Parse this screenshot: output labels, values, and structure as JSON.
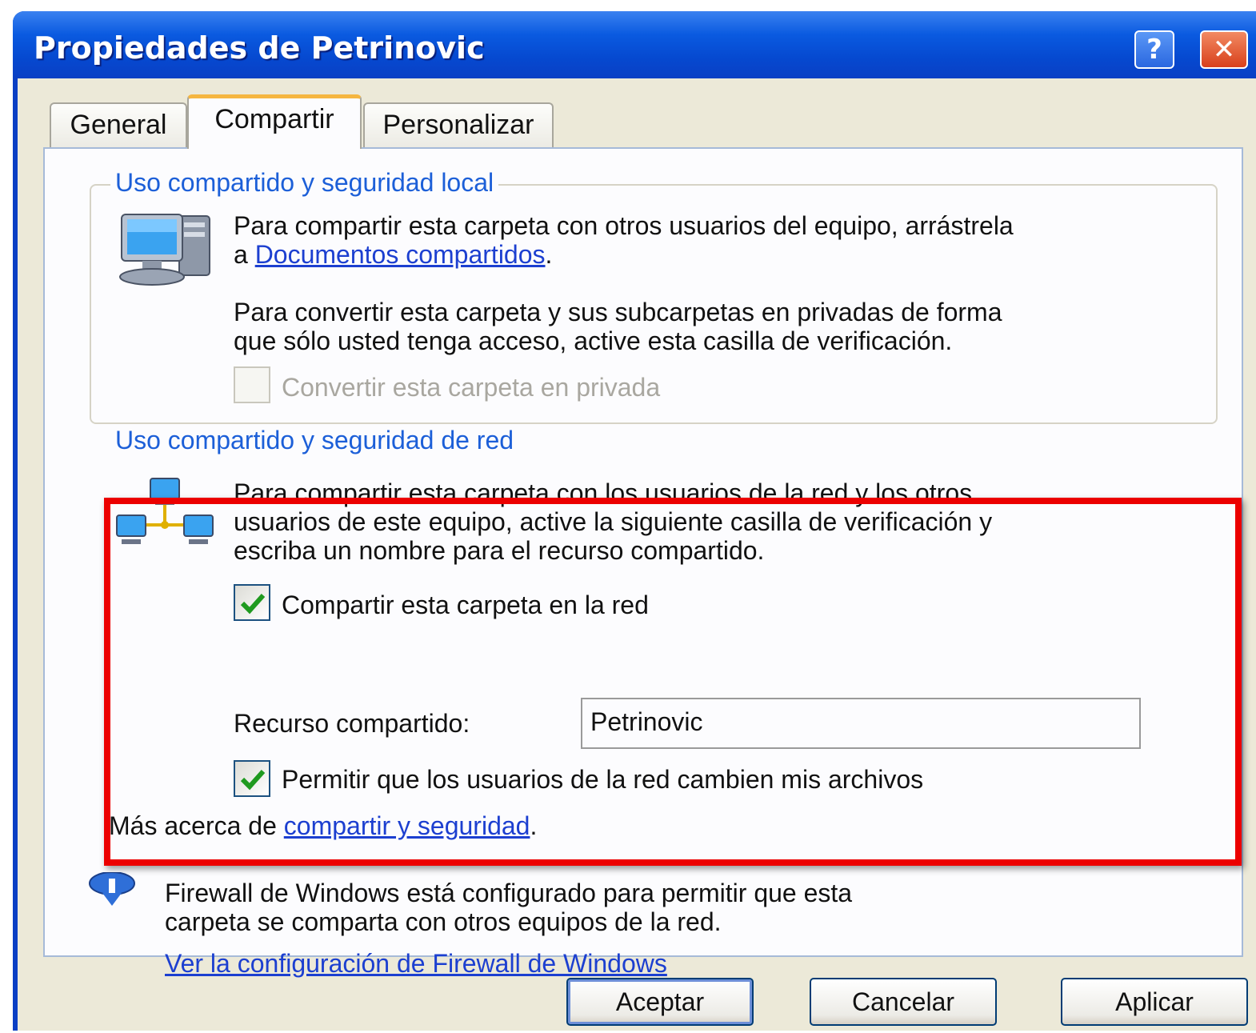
{
  "window": {
    "title": "Propiedades de Petrinovic",
    "help_label": "?",
    "close_label": "✕"
  },
  "tabs": [
    {
      "label": "General",
      "active": false
    },
    {
      "label": "Compartir",
      "active": true
    },
    {
      "label": "Personalizar",
      "active": false
    }
  ],
  "local_sharing": {
    "group_label": "Uso compartido y seguridad local",
    "text_1": "Para compartir esta carpeta con otros usuarios del equipo, arrástrela",
    "text_2_prefix": "a ",
    "link": "Documentos compartidos",
    "text_2_suffix": ".",
    "text_3": "Para convertir esta carpeta y sus subcarpetas en privadas de forma",
    "text_4": "que sólo usted tenga acceso, active esta casilla de verificación.",
    "private_checkbox_label": "Convertir esta carpeta en privada",
    "private_checked": false
  },
  "network_sharing": {
    "group_label": "Uso compartido y seguridad de red",
    "text_1": "Para compartir esta carpeta con los usuarios de la red y los otros",
    "text_2": "usuarios de este equipo, active la siguiente casilla de verificación y",
    "text_3": "escriba un nombre para el recurso compartido.",
    "share_checkbox_label": "Compartir esta carpeta en la red",
    "share_checked": true,
    "share_name_label": "Recurso compartido:",
    "share_name_value": "Petrinovic",
    "allow_change_label": "Permitir que los usuarios de la red cambien mis archivos",
    "allow_change_checked": true,
    "more_prefix": "Más acerca de ",
    "more_link": "compartir y seguridad",
    "more_suffix": "."
  },
  "firewall": {
    "text_1": "Firewall de Windows está configurado para permitir que esta",
    "text_2": "carpeta se comparta con otros equipos de la red.",
    "link": "Ver la configuración de Firewall de Windows"
  },
  "buttons": {
    "ok": "Aceptar",
    "cancel": "Cancelar",
    "apply": "Aplicar"
  },
  "colors": {
    "titlebar": "#0a5ae0",
    "highlight": "#ec0000",
    "link": "#1c3fd0",
    "group_label": "#1c5fd8"
  }
}
